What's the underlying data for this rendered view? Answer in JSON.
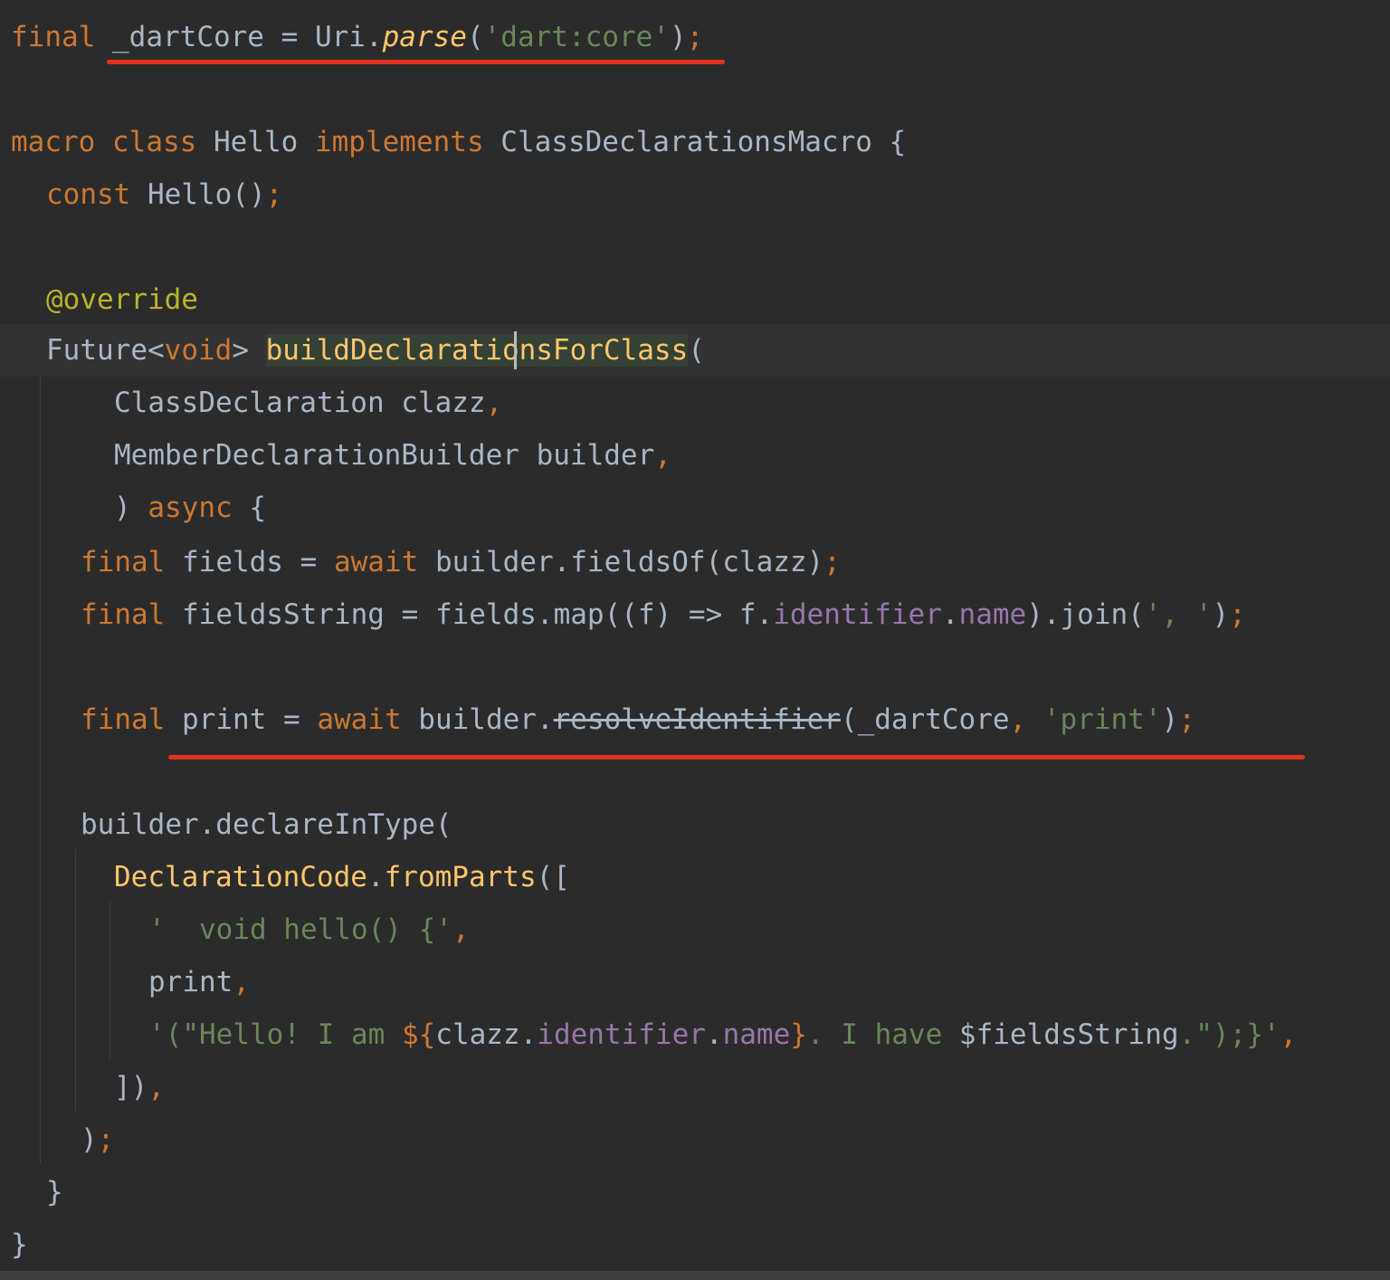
{
  "editor": {
    "lines": {
      "l1": [
        "final",
        " ",
        "_dartCore",
        " = Uri.",
        "parse",
        "(",
        "'dart:core'",
        ")",
        ";"
      ],
      "l3": [
        "macro",
        " ",
        "class",
        " Hello ",
        "implements",
        " ClassDeclarationsMacro {"
      ],
      "l4": [
        "const",
        " Hello()",
        ";"
      ],
      "l6": [
        "@override"
      ],
      "l7": [
        "Future<",
        "void",
        "> ",
        "buildDeclarati",
        "onsForClass",
        "("
      ],
      "l8": [
        "ClassDeclaration clazz",
        ","
      ],
      "l9": [
        "MemberDeclarationBuilder builder",
        ","
      ],
      "l10": [
        ") ",
        "async",
        " {"
      ],
      "l11": [
        "final",
        " fields = ",
        "await",
        " builder.fieldsOf(clazz)",
        ";"
      ],
      "l12": [
        "final",
        " fieldsString = fields.map((f) => f.",
        "identifier",
        ".",
        "name",
        ").join(",
        "', '",
        ")",
        ";"
      ],
      "l14": [
        "final",
        " print = ",
        "await",
        " builder.",
        "resolveIdentifier",
        "(_dartCore",
        ", ",
        "'print'",
        ")",
        ";"
      ],
      "l16": [
        "builder.declareInType("
      ],
      "l17": [
        "DeclarationCode",
        ".",
        "fromParts",
        "(["
      ],
      "l18": [
        "'  void hello() {'",
        ","
      ],
      "l19": [
        "print",
        ","
      ],
      "l20": [
        "'(\"Hello! I am ",
        "${",
        "clazz.",
        "identifier",
        ".",
        "name",
        "}",
        ". I have ",
        "$fieldsString",
        ".\");}'",
        ","
      ],
      "l21": [
        "])",
        ","
      ],
      "l22": [
        ")",
        ";"
      ],
      "l23": [
        "}"
      ],
      "l24": [
        "}"
      ]
    },
    "annotation_color": "#e0321c",
    "caret_after": "buildDeclarati"
  }
}
